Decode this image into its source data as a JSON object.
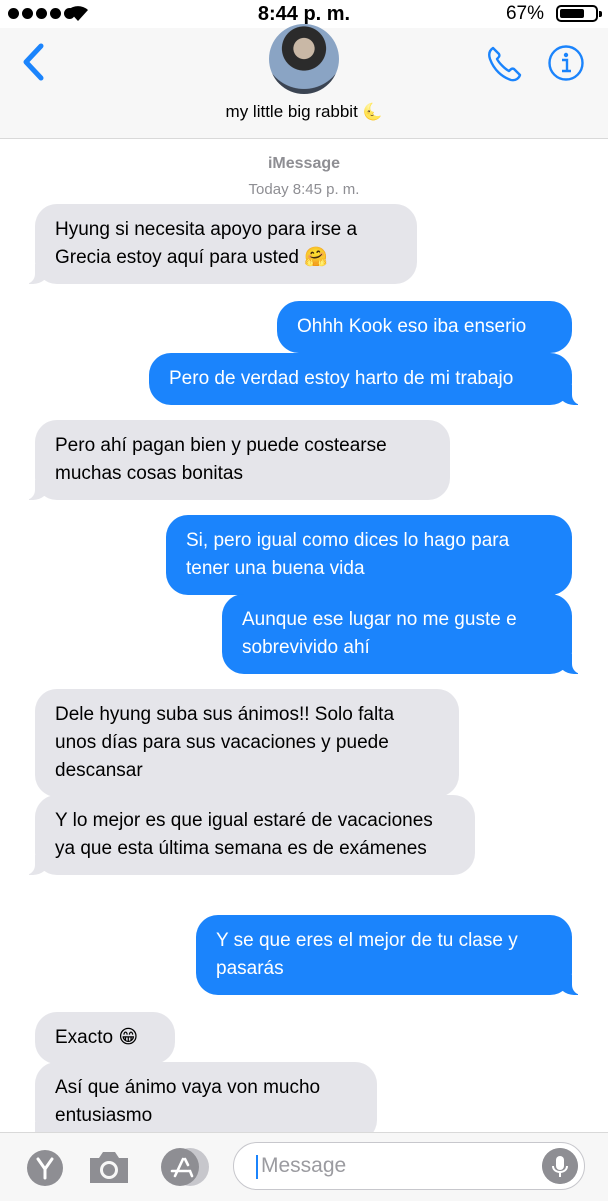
{
  "status_bar": {
    "time": "8:44 p. m.",
    "battery_percent": "67%",
    "battery_level": 0.67
  },
  "header": {
    "contact_name": "my little big rabbit",
    "contact_emoji": "🌜"
  },
  "conversation": {
    "service": "iMessage",
    "timestamp": "Today 8:45 p. m.",
    "messages": [
      {
        "from": "them",
        "text": "Hyung si necesita apoyo para irse a Grecia estoy aquí para usted 🤗"
      },
      {
        "from": "me",
        "text": "Ohhh Kook eso iba enserio"
      },
      {
        "from": "me",
        "text": "Pero de verdad estoy harto de mi trabajo"
      },
      {
        "from": "them",
        "text": "Pero ahí pagan bien y puede costearse muchas cosas bonitas"
      },
      {
        "from": "me",
        "text": "Si, pero igual como dices lo hago para tener una buena vida"
      },
      {
        "from": "me",
        "text": "Aunque ese lugar no me guste e sobrevivido ahí"
      },
      {
        "from": "them",
        "text": "Dele hyung suba sus ánimos!! Solo falta unos días para sus vacaciones y puede descansar"
      },
      {
        "from": "them",
        "text": "Y lo mejor es que igual estaré de vacaciones ya que esta última semana es de exámenes"
      },
      {
        "from": "me",
        "text": "Y se que eres el mejor de tu clase y pasarás"
      },
      {
        "from": "them",
        "text": "Exacto 😁"
      },
      {
        "from": "them",
        "text": "Así que ánimo vaya von mucho entusiasmo"
      }
    ]
  },
  "input_bar": {
    "placeholder": "Message",
    "avatar_letter": "Y"
  },
  "colors": {
    "sent_bubble": "#1b84fc",
    "received_bubble": "#e5e5ea",
    "ios_blue": "#1b84fc"
  }
}
